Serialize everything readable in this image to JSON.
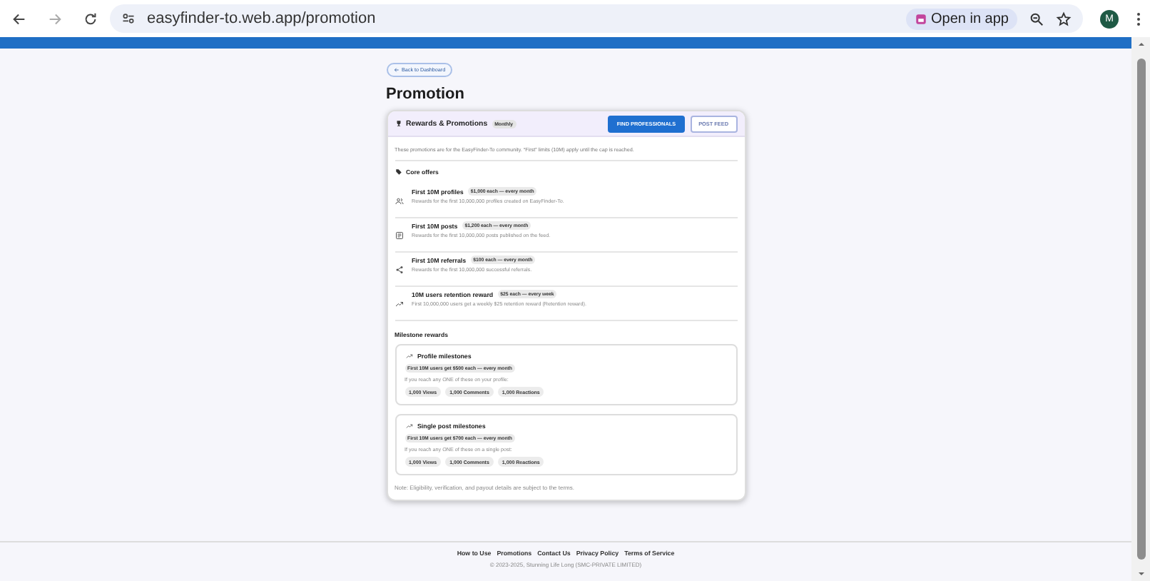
{
  "browser": {
    "url": "easyfinder-to.web.app/promotion",
    "open_in_app": "Open in app",
    "avatar": "M"
  },
  "back_link": "Back to Dashboard",
  "title": "Promotion",
  "card": {
    "heading": "Rewards & Promotions",
    "badge": "Monthly",
    "buttons": [
      {
        "label": "FIND PROFESSIONALS",
        "kind": "primary"
      },
      {
        "label": "POST FEED",
        "kind": "outline"
      }
    ],
    "intro": "These promotions are for the EasyFinder-To community. “First” limits (10M) apply until the cap is reached.",
    "core_heading": "Core offers",
    "offers": [
      {
        "kind": "profiles",
        "title": "First 10M profiles",
        "tag": "$1,000 each — every month",
        "description": "Rewards for the first 10,000,000 profiles created on EasyFinder-To."
      },
      {
        "kind": "posts",
        "title": "First 10M posts",
        "tag": "$1,200 each — every month",
        "description": "Rewards for the first 10,000,000 posts published on the feed."
      },
      {
        "kind": "referrals",
        "title": "First 10M referrals",
        "tag": "$100 each — every month",
        "description": "Rewards for the first 10,000,000 successful referrals."
      },
      {
        "kind": "retention",
        "title": "10M users retention reward",
        "tag": "$25 each — every week",
        "description": "First 10,000,000 users get a weekly $25 retention reward (Retention reward)."
      }
    ],
    "milestone_heading": "Milestone rewards",
    "milestones": [
      {
        "title": "Profile milestones",
        "tag": "First 10M users get $500 each — every month",
        "condition": "If you reach any ONE of these on your profile:",
        "chips": [
          "1,000 Views",
          "1,000 Comments",
          "1,000 Reactions"
        ]
      },
      {
        "title": "Single post milestones",
        "tag": "First 10M users get $700 each — every month",
        "condition": "If you reach any ONE of these on a single post:",
        "chips": [
          "1,000 Views",
          "1,000 Comments",
          "1,000 Reactions"
        ]
      }
    ],
    "note": "Note: Eligibility, verification, and payout details are subject to the terms."
  },
  "footer": {
    "links": [
      "How to Use",
      "Promotions",
      "Contact Us",
      "Privacy Policy",
      "Terms of Service"
    ],
    "copyright": "© 2023-2025, Stunning Life Long (SMC-PRIVATE LIMITED)"
  }
}
